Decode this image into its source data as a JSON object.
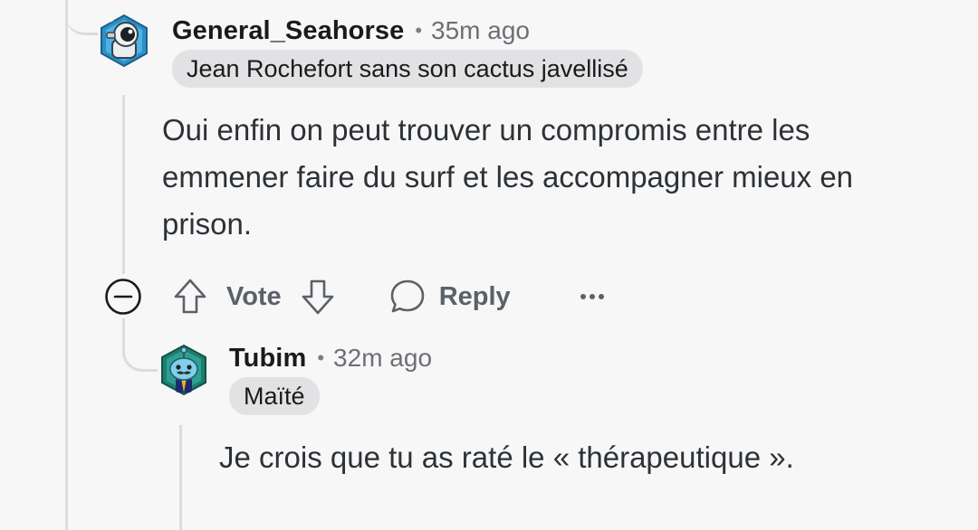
{
  "comments": [
    {
      "username": "General_Seahorse",
      "separator": "•",
      "timestamp": "35m ago",
      "flair": "Jean Rochefort sans son cactus javellisé",
      "body": "Oui enfin on peut trouver un compromis entre les emmener faire du surf et les accompagner mieux en prison.",
      "avatar": "astronaut-snoo-icon"
    },
    {
      "username": "Tubim",
      "separator": "•",
      "timestamp": "32m ago",
      "flair": "Maïté",
      "body": "Je crois que tu as raté le « thérapeutique ».",
      "avatar": "blue-mustache-snoo-icon"
    }
  ],
  "actions": {
    "vote_label": "Vote",
    "reply_label": "Reply",
    "collapse_icon": "minus-circle-icon",
    "upvote_icon": "arrow-up-icon",
    "downvote_icon": "arrow-down-icon",
    "reply_icon": "speech-bubble-icon",
    "more_icon": "ellipsis-icon"
  },
  "colors": {
    "background": "#f7f7f8",
    "thread_line": "#dcdcdf",
    "flair_background": "#e2e2e4",
    "action_text": "#5b6168"
  }
}
